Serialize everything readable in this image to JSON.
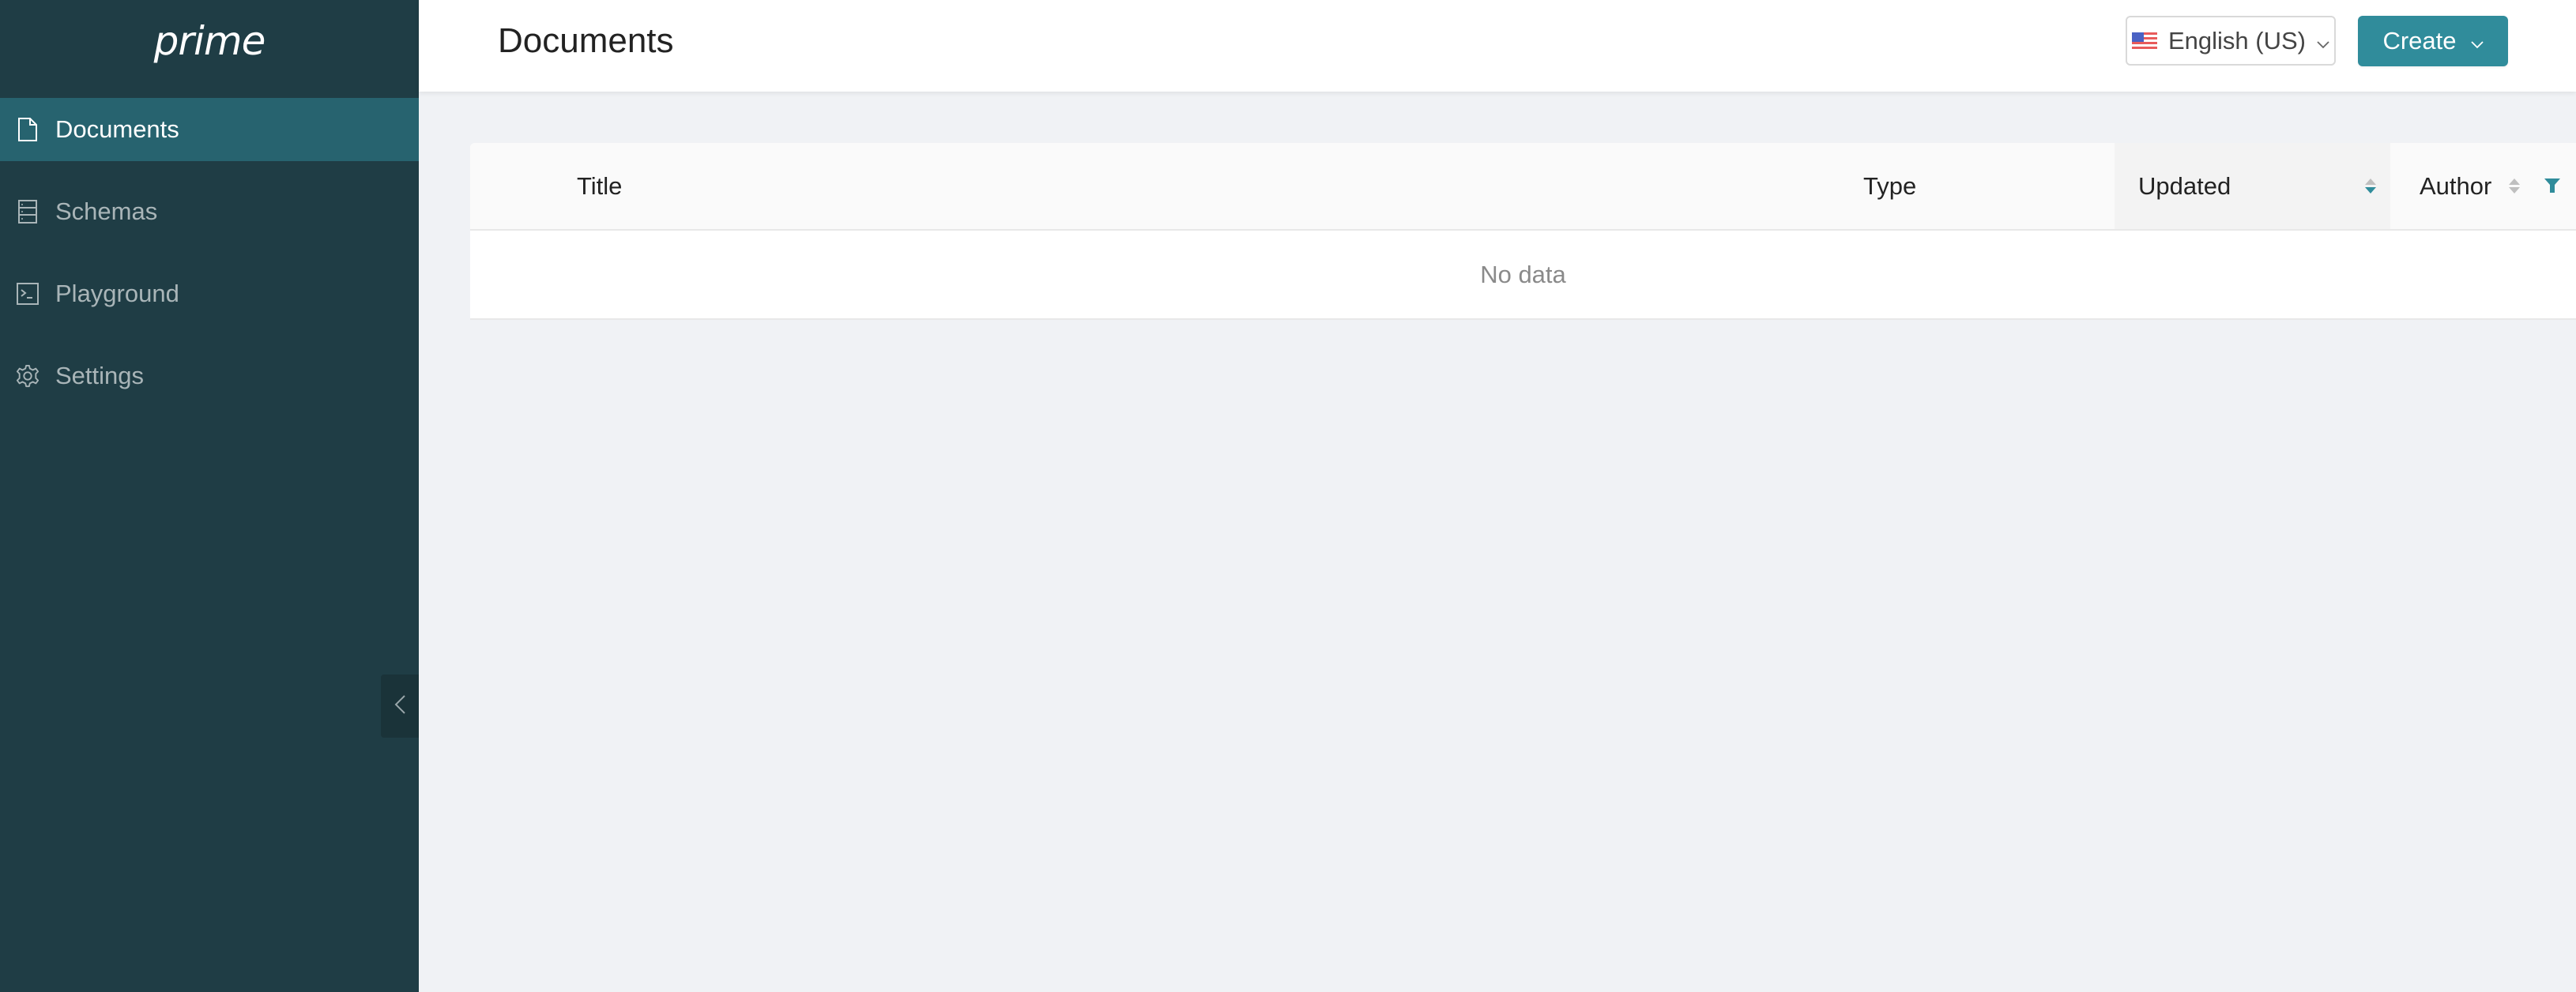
{
  "app": {
    "logo": "prime"
  },
  "sidebar": {
    "items": [
      {
        "label": "Documents",
        "icon": "file-icon",
        "active": true
      },
      {
        "label": "Schemas",
        "icon": "schema-icon",
        "active": false
      },
      {
        "label": "Playground",
        "icon": "terminal-icon",
        "active": false
      },
      {
        "label": "Settings",
        "icon": "gear-icon",
        "active": false
      }
    ],
    "collapse_icon": "chevron-left-icon"
  },
  "header": {
    "title": "Documents",
    "language": {
      "label": "English (US)",
      "icon": "us-flag-icon"
    },
    "create_label": "Create"
  },
  "table": {
    "columns": [
      {
        "label": "Title"
      },
      {
        "label": "Type"
      },
      {
        "label": "Updated",
        "sorted": "descending"
      },
      {
        "label": "Author",
        "sortable": true,
        "filter_active": true
      }
    ],
    "empty_text": "No data"
  },
  "colors": {
    "sidebar_bg": "#1f3d45",
    "sidebar_active": "#27636f",
    "accent": "#308c9b",
    "page_bg": "#f0f2f5"
  }
}
